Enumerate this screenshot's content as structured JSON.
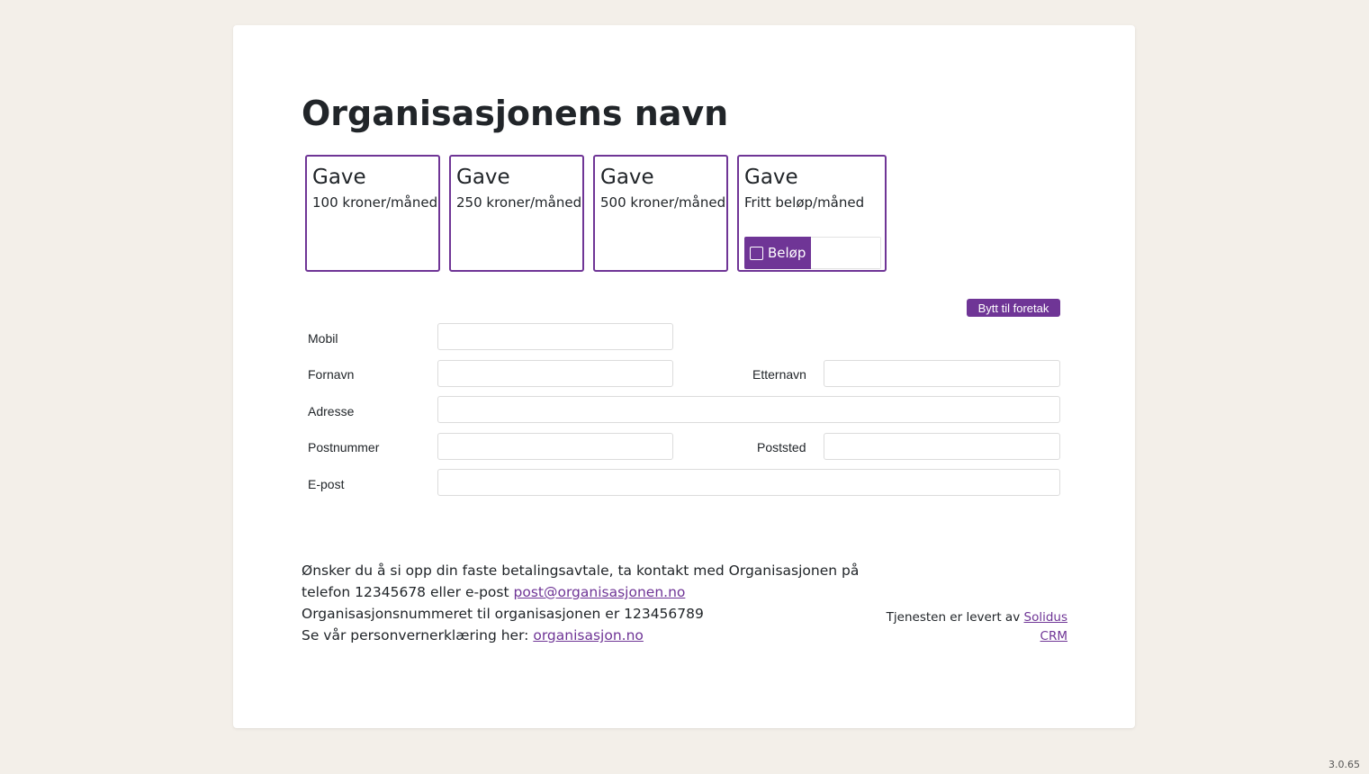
{
  "header": {
    "title": "Organisasjonens navn"
  },
  "gifts": [
    {
      "title": "Gave",
      "subtitle": "100 kroner/måned"
    },
    {
      "title": "Gave",
      "subtitle": "250 kroner/måned"
    },
    {
      "title": "Gave",
      "subtitle": "500 kroner/måned"
    },
    {
      "title": "Gave",
      "subtitle": "Fritt beløp/måned",
      "amount_label": "Beløp",
      "amount_value": ""
    }
  ],
  "form": {
    "switch_label": "Bytt til foretak",
    "mobile": {
      "label": "Mobil",
      "value": ""
    },
    "first_name": {
      "label": "Fornavn",
      "value": ""
    },
    "last_name": {
      "label": "Etternavn",
      "value": ""
    },
    "address": {
      "label": "Adresse",
      "value": ""
    },
    "postcode": {
      "label": "Postnummer",
      "value": ""
    },
    "city": {
      "label": "Poststed",
      "value": ""
    },
    "email": {
      "label": "E-post",
      "value": ""
    }
  },
  "info": {
    "line1": "Ønsker du å si opp din faste betalingsavtale, ta kontakt med Organisasjonen på telefon 12345678 eller e-post",
    "email_link": "post@organisasjonen.no",
    "line2": "Organisasjonsnummeret til organisasjonen er 123456789",
    "privacy_prefix": "Se vår personvernerklæring her:",
    "privacy_link": "organisasjon.no"
  },
  "credit": {
    "prefix": "Tjenesten er levert av",
    "link": "Solidus CRM"
  },
  "version": "3.0.65",
  "colors": {
    "accent": "#6f3596",
    "background": "#f3efe9"
  }
}
